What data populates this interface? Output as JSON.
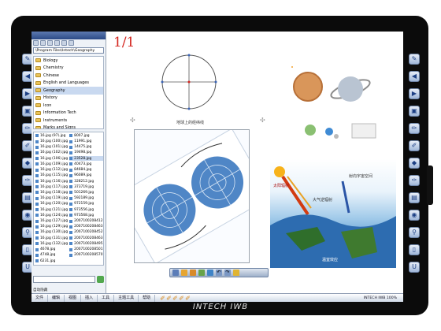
{
  "page_indicator": "1/1",
  "brand_label": "INTECH IWB",
  "panel": {
    "title": "",
    "path": "\\Program Files\\Intech\\Geography",
    "folders": [
      {
        "label": "Biology",
        "selected": false
      },
      {
        "label": "Chemistry",
        "selected": false
      },
      {
        "label": "Chinese",
        "selected": false
      },
      {
        "label": "English and Languages",
        "selected": false
      },
      {
        "label": "Geography",
        "selected": true
      },
      {
        "label": "History",
        "selected": false
      },
      {
        "label": "Icon",
        "selected": false
      },
      {
        "label": "Information Tech",
        "selected": false
      },
      {
        "label": "Instruments",
        "selected": false
      },
      {
        "label": "Marks and Signs",
        "selected": false
      }
    ],
    "files": [
      "16.jpg (97).jpg",
      "8007.jpg",
      "16.jpg (100).jpg",
      "11991.jpg",
      "16.jpg (101).jpg",
      "14475.jpg",
      "16.jpg (102).jpg",
      "19498.jpg",
      "16.jpg (106).jpg",
      "23528.jpg",
      "16.jpg (109).jpg",
      "40473.jpg",
      "16.jpg (112).jpg",
      "84684.jpg",
      "16.jpg (115).jpg",
      "96089.jpg",
      "16.jpg (116).jpg",
      "328212.jpg",
      "16.jpg (117).jpg",
      "373719.jpg",
      "16.jpg (118).jpg",
      "501269.jpg",
      "16.jpg (119).jpg",
      "592189.jpg",
      "16.jpg (120).jpg",
      "972159.jpg",
      "16.jpg (121).jpg",
      "973556.jpg",
      "16.jpg (124).jpg",
      "973568.jpg",
      "16.jpg (127).jpg",
      "2007100208412",
      "16.jpg (129).jpg",
      "2007100208463",
      "16.jpg (130).jpg",
      "2007100208452",
      "16.jpg (131).jpg",
      "2007100208463",
      "16.jpg (132).jpg",
      "2007100208495",
      "4678.jpg",
      "2007100208501",
      "4748.jpg",
      "2007100208570",
      "6231.jpg",
      ""
    ],
    "selected_file_index": 9,
    "bottom_label": "自动隐藏"
  },
  "canvas": {
    "globe_caption": "地球上的经纬线",
    "sphere_caption": "",
    "atmos_caption": "温室效应",
    "atmos_labels": [
      "太阳辐射",
      "大气逆辐射",
      "射向宇宙空间"
    ]
  },
  "taskbar": {
    "menus": [
      "文件",
      "编辑",
      "视图",
      "插入",
      "工具",
      "主题工具",
      "帮助"
    ],
    "status": "INTECH IWB 100%"
  },
  "colors": {
    "frame": "#0b0b0b",
    "accent": "#d4261f",
    "panel_bg": "#eef2f7"
  }
}
